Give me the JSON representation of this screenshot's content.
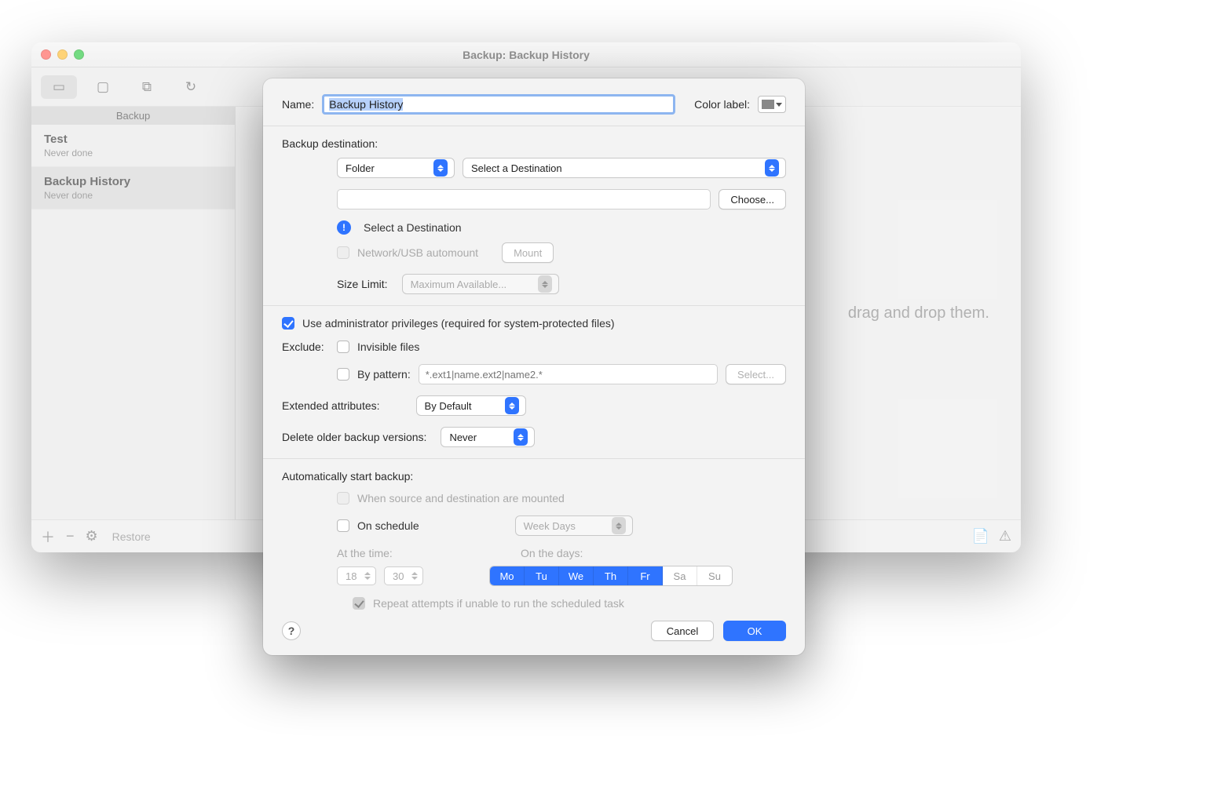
{
  "window": {
    "title": "Backup: Backup History"
  },
  "sidebar": {
    "section_label": "Backup",
    "tasks": [
      {
        "name": "Test",
        "status": "Never done"
      },
      {
        "name": "Backup History",
        "status": "Never done"
      }
    ]
  },
  "main_hint": "drag and drop them.",
  "bottombar": {
    "restore_label": "Restore"
  },
  "sheet": {
    "name_label": "Name:",
    "name_value": "Backup History",
    "color_label": "Color label:",
    "destination_section": "Backup destination:",
    "destination_type": "Folder",
    "destination_select": "Select a Destination",
    "destination_path": "",
    "choose_label": "Choose...",
    "destination_warning": "Select a Destination",
    "automount_label": "Network/USB automount",
    "mount_label": "Mount",
    "sizelimit_label": "Size Limit:",
    "sizelimit_value": "Maximum Available...",
    "admin_label": "Use administrator privileges (required for system-protected files)",
    "exclude_label": "Exclude:",
    "exclude_invisible": "Invisible files",
    "exclude_bypattern": "By pattern:",
    "pattern_placeholder": "*.ext1|name.ext2|name2.*",
    "select_button": "Select...",
    "extattr_label": "Extended attributes:",
    "extattr_value": "By Default",
    "delete_label": "Delete older backup versions:",
    "delete_value": "Never",
    "auto_label": "Automatically start backup:",
    "auto_mounted": "When source and destination are mounted",
    "auto_schedule": "On schedule",
    "schedule_type": "Week Days",
    "attime_label": "At the time:",
    "attime_hour": "18",
    "attime_min": "30",
    "ondays_label": "On the days:",
    "days": [
      {
        "abbr": "Mo",
        "on": true
      },
      {
        "abbr": "Tu",
        "on": true
      },
      {
        "abbr": "We",
        "on": true
      },
      {
        "abbr": "Th",
        "on": true
      },
      {
        "abbr": "Fr",
        "on": true
      },
      {
        "abbr": "Sa",
        "on": false
      },
      {
        "abbr": "Su",
        "on": false
      }
    ],
    "repeat_label": "Repeat attempts if unable to run the scheduled task",
    "cancel_label": "Cancel",
    "ok_label": "OK"
  }
}
